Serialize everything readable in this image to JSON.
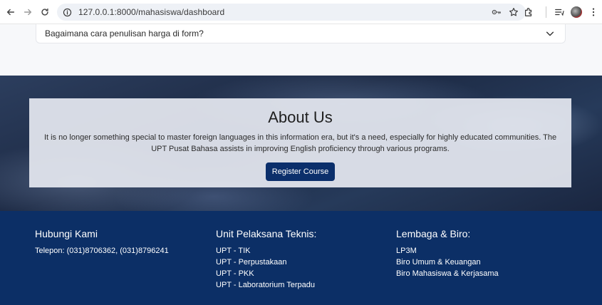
{
  "browser": {
    "url": "127.0.0.1:8000/mahasiswa/dashboard"
  },
  "faq": {
    "question": "Bagaimana cara penulisan harga di form?"
  },
  "about": {
    "title": "About Us",
    "text": "It is no longer something special to master foreign languages in this information era, but it's a need, especially for highly educated communities. The UPT Pusat Bahasa assists in improving English proficiency through various programs.",
    "button": "Register Course"
  },
  "footer": {
    "contact": {
      "heading": "Hubungi Kami",
      "phone": "Telepon: (031)8706362, (031)8796241"
    },
    "units": {
      "heading": "Unit Pelaksana Teknis:",
      "items": [
        "UPT - TIK",
        "UPT - Perpustakaan",
        "UPT - PKK",
        "UPT - Laboratorium Terpadu"
      ]
    },
    "institutions": {
      "heading": "Lembaga & Biro:",
      "items": [
        "LP3M",
        "Biro Umum & Keuangan",
        "Biro Mahasiswa & Kerjasama"
      ]
    }
  },
  "colors": {
    "footer_bg": "#0c2f66",
    "button_bg": "#0b2f6b",
    "card_bg": "#e2e5ee"
  }
}
